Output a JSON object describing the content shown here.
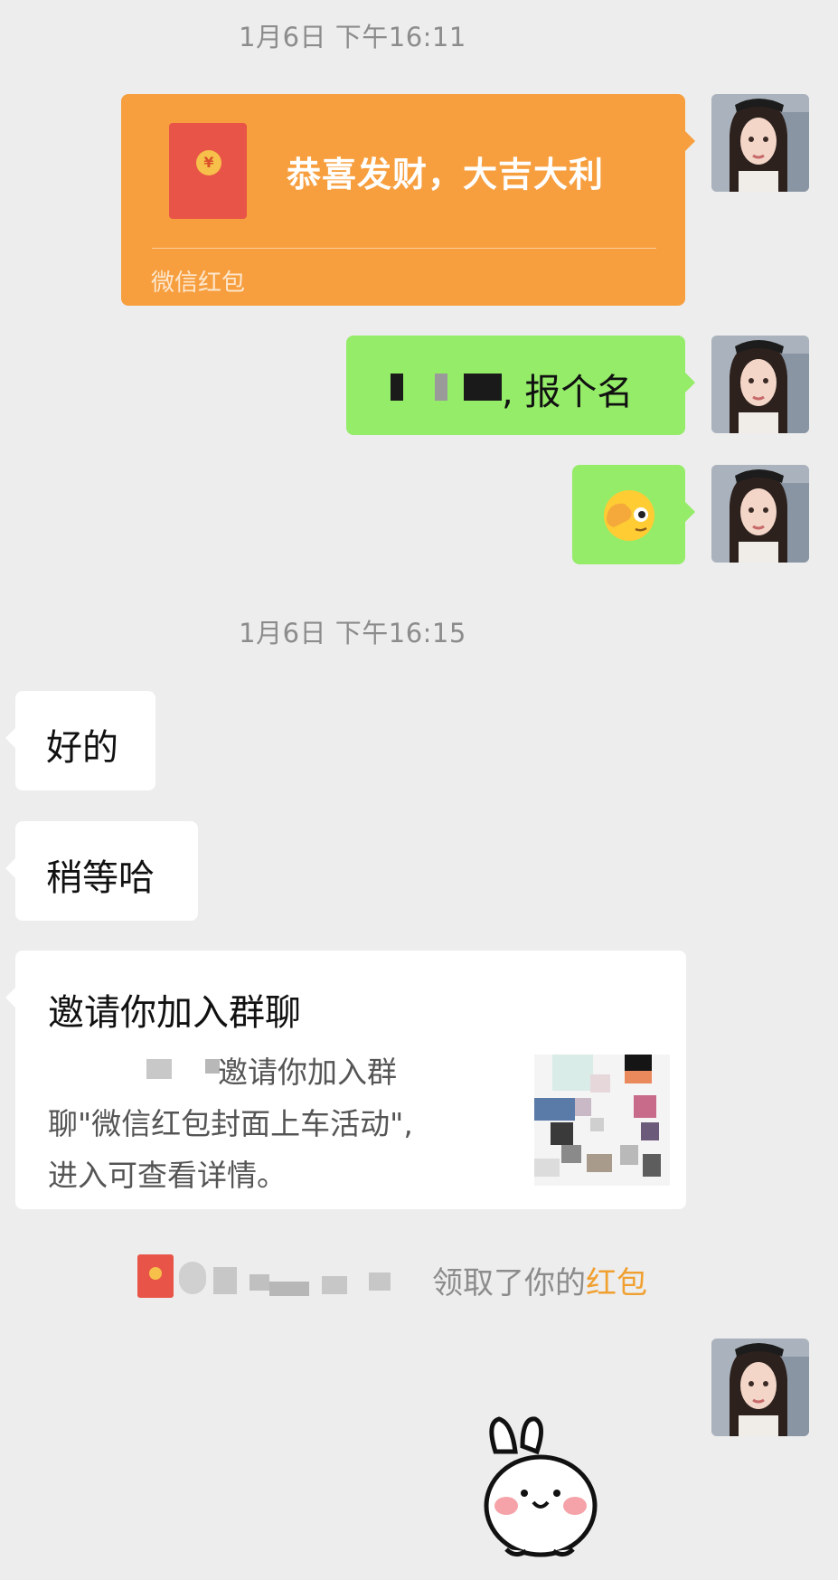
{
  "timestamps": [
    "1月6日 下午16:11",
    "1月6日 下午16:15"
  ],
  "red_packet_card": {
    "greeting": "恭喜发财，大吉大利",
    "label": "微信红包",
    "coin_symbol": "¥"
  },
  "messages": {
    "signup_suffix": ", 报个名",
    "reply_1": "好的",
    "reply_2": "稍等哈"
  },
  "invite_card": {
    "title": "邀请你加入群聊",
    "line1": "邀请你加入群",
    "line2": "聊\"微信红包封面上车活动\",",
    "line3": "进入可查看详情。"
  },
  "system_notice": {
    "prefix": "领取了你的",
    "highlight": "红包"
  },
  "colors": {
    "background": "#ededed",
    "sent_bubble": "#95ec69",
    "received_bubble": "#ffffff",
    "red_packet": "#f79f3f",
    "envelope": "#e85447",
    "highlight": "#f0a030"
  },
  "icons": [
    "red-packet-icon",
    "facepalm-emoji-icon",
    "bunny-sticker-icon"
  ]
}
